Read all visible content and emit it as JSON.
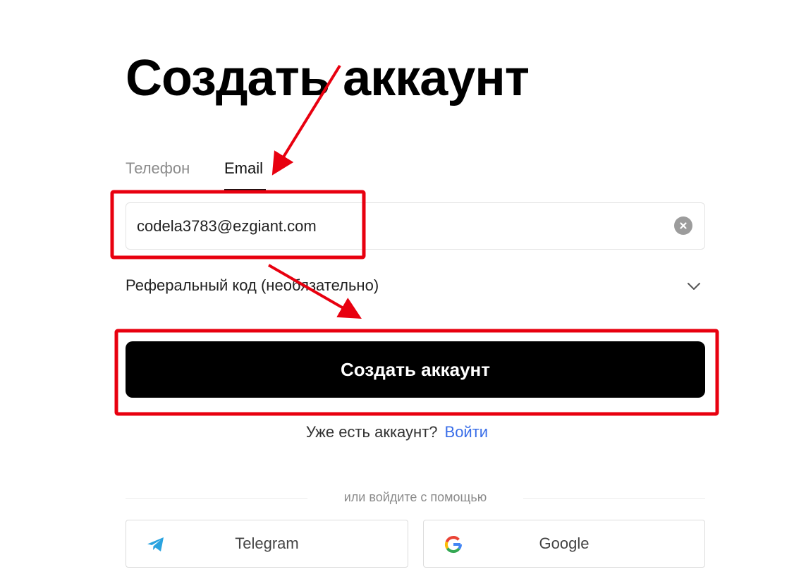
{
  "page": {
    "title": "Создать аккаунт"
  },
  "tabs": [
    {
      "label": "Телефон",
      "active": false
    },
    {
      "label": "Email",
      "active": true
    }
  ],
  "email_field": {
    "value": "codela3783@ezgiant.com",
    "clear_icon": "clear-circle-icon"
  },
  "referral": {
    "label": "Реферальный код (необязательно)",
    "icon": "chevron-down-icon"
  },
  "create_button": {
    "label": "Создать аккаунт"
  },
  "login": {
    "prompt": "Уже есть аккаунт?",
    "link": "Войти"
  },
  "divider": {
    "text": "или войдите с помощью"
  },
  "social": [
    {
      "label": "Telegram",
      "icon": "telegram-icon"
    },
    {
      "label": "Google",
      "icon": "google-icon"
    }
  ],
  "colors": {
    "primary_button": "#000000",
    "link": "#3a6ee8",
    "annotation": "#e8000f",
    "inactive_tab": "#8b8b8b"
  }
}
